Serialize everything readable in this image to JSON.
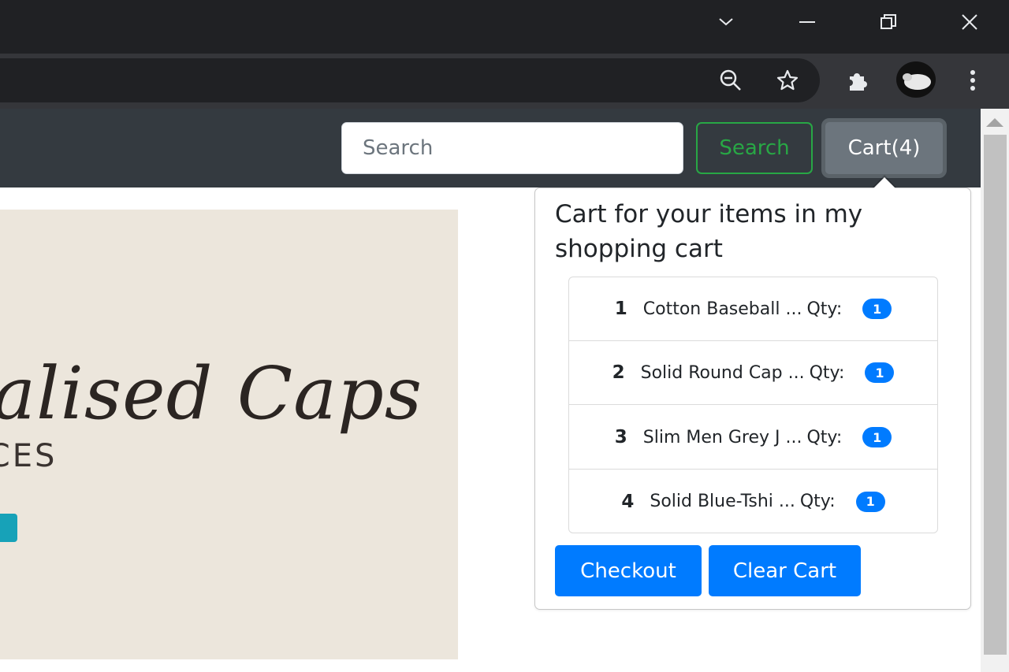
{
  "browser": {
    "window_controls": {
      "tab_search": "chevron-down-icon",
      "minimize": "minimize-icon",
      "restore": "restore-icon",
      "close": "close-icon"
    },
    "toolbar_icons": [
      "zoom-out-icon",
      "star-icon",
      "extensions-icon",
      "avatar",
      "more-icon"
    ]
  },
  "navbar": {
    "search_placeholder": "Search",
    "search_button": "Search",
    "cart_button": "Cart(4)"
  },
  "hero": {
    "script_text": "nalised Caps",
    "subtitle": "ICES"
  },
  "cart_popover": {
    "title": "Cart for your items in my shopping cart",
    "items": [
      {
        "num": "1",
        "name": "Cotton Baseball ...",
        "qty_label": "Qty:",
        "qty": "1"
      },
      {
        "num": "2",
        "name": "Solid Round Cap ...",
        "qty_label": "Qty:",
        "qty": "1"
      },
      {
        "num": "3",
        "name": "Slim Men Grey J ...",
        "qty_label": "Qty:",
        "qty": "1"
      },
      {
        "num": "4",
        "name": "Solid Blue-Tshi ...",
        "qty_label": "Qty:",
        "qty": "1"
      }
    ],
    "checkout_button": "Checkout",
    "clear_button": "Clear Cart"
  },
  "colors": {
    "primary": "#007bff",
    "success": "#28a745",
    "secondary": "#6c757d",
    "navbar": "#343a40",
    "hero_bg": "#ece6dc"
  }
}
